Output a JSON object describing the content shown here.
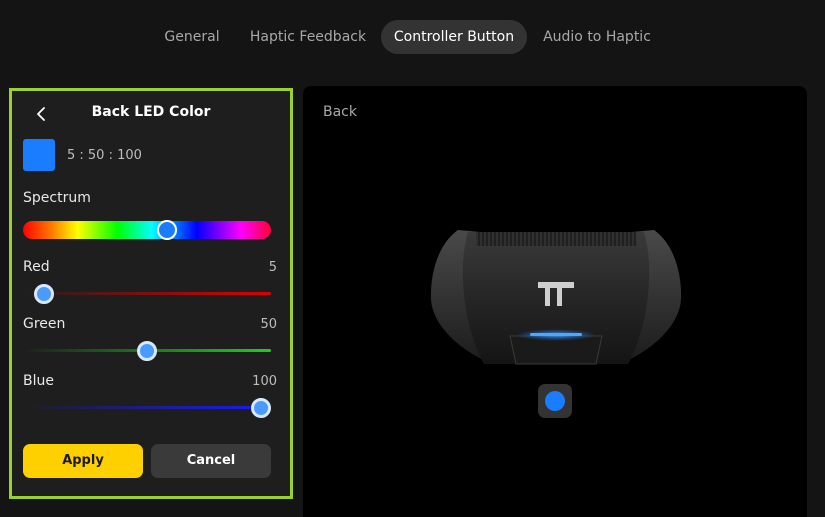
{
  "tabs": [
    {
      "label": "General",
      "active": false
    },
    {
      "label": "Haptic Feedback",
      "active": false
    },
    {
      "label": "Controller Button",
      "active": true
    },
    {
      "label": "Audio to Haptic",
      "active": false
    }
  ],
  "panel": {
    "title": "Back LED Color",
    "color_hex": "#1a7cff",
    "color_value": "5 : 50 : 100",
    "spectrum": {
      "label": "Spectrum",
      "position": 0.58
    },
    "red": {
      "label": "Red",
      "value": "5",
      "min": 0,
      "max": 100,
      "color": "#e00000"
    },
    "green": {
      "label": "Green",
      "value": "50",
      "min": 0,
      "max": 100,
      "color": "#1bd01b"
    },
    "blue": {
      "label": "Blue",
      "value": "100",
      "min": 0,
      "max": 100,
      "color": "#1a1aff"
    },
    "apply_label": "Apply",
    "cancel_label": "Cancel"
  },
  "preview": {
    "title": "Back",
    "led_color": "#1a7cff"
  },
  "icons": {
    "back": "chevron-left-icon"
  },
  "colors": {
    "accent_border": "#9bd12d",
    "apply": "#ffd000"
  }
}
